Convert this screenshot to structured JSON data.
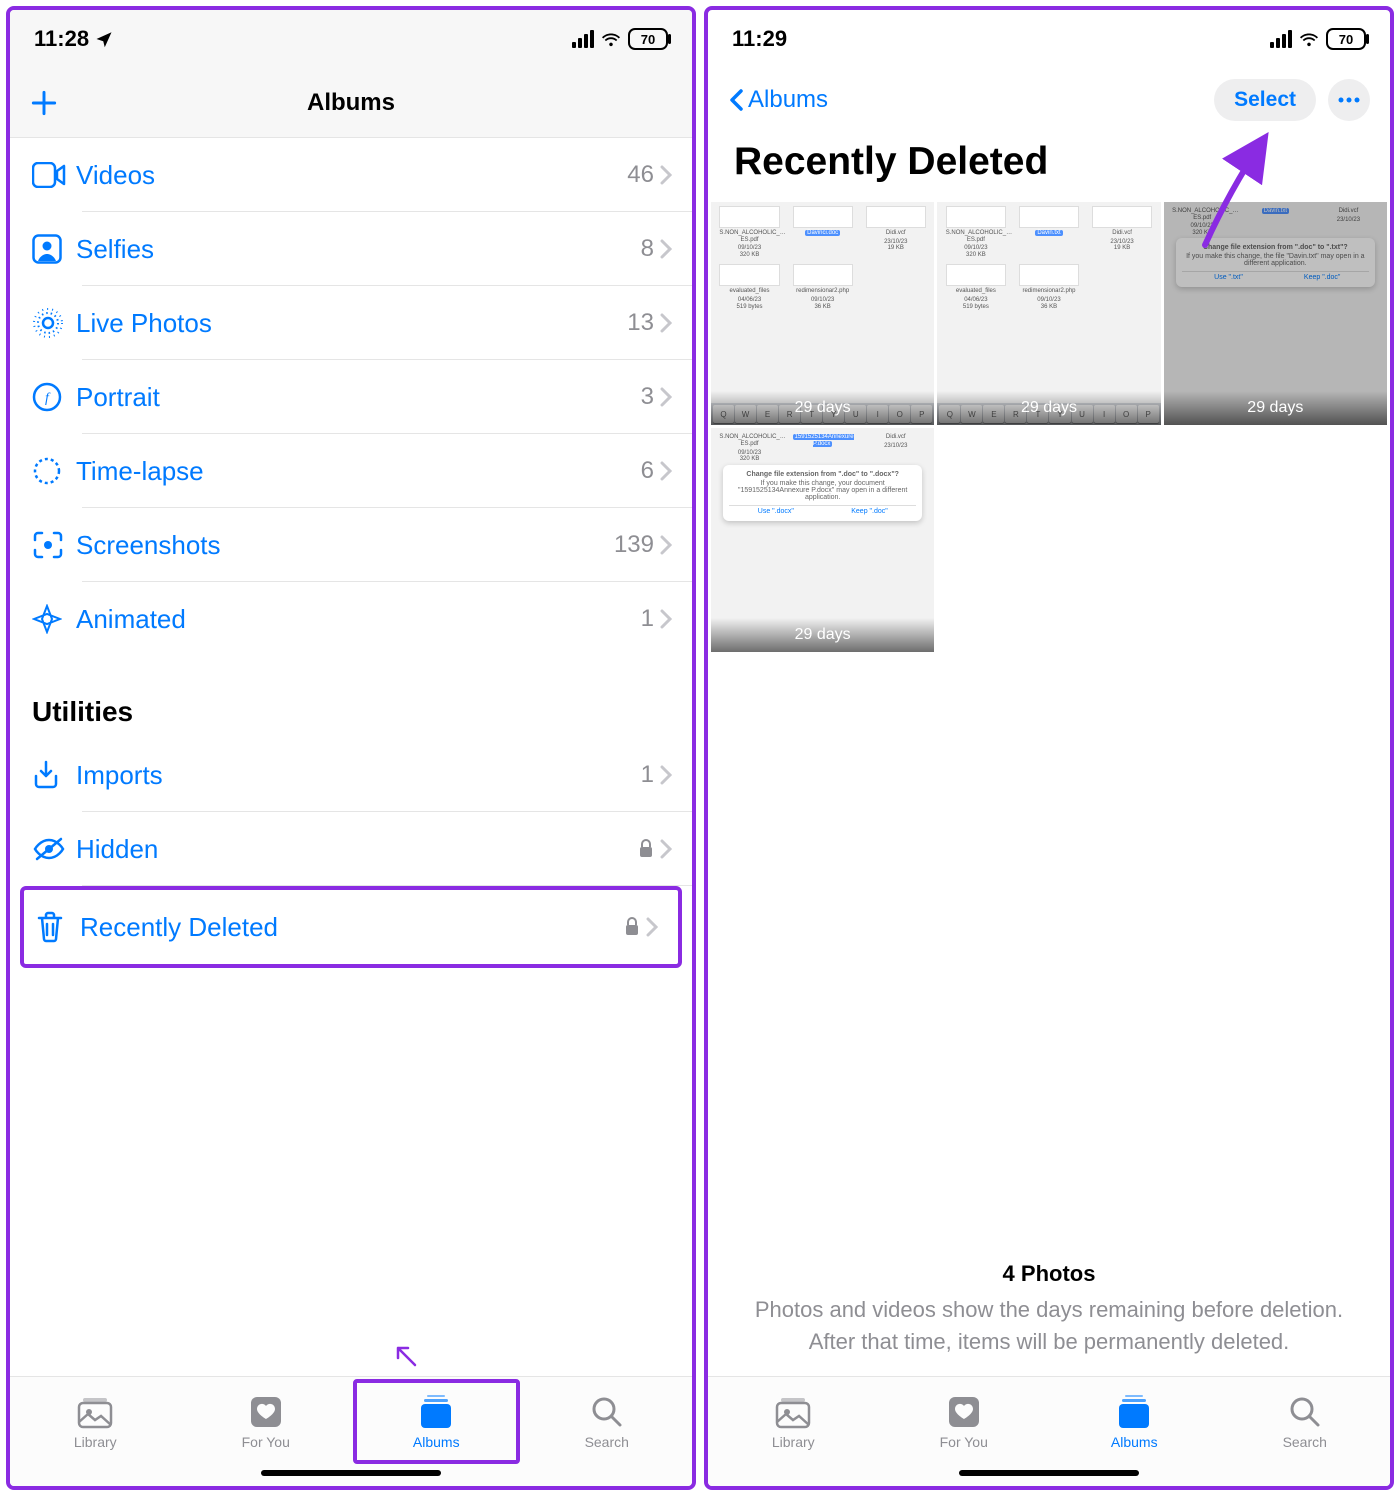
{
  "left": {
    "status": {
      "time": "11:28",
      "battery": "70"
    },
    "nav_title": "Albums",
    "media_types": [
      {
        "icon": "video",
        "label": "Videos",
        "count": "46"
      },
      {
        "icon": "person",
        "label": "Selfies",
        "count": "8"
      },
      {
        "icon": "live",
        "label": "Live Photos",
        "count": "13"
      },
      {
        "icon": "aperture",
        "label": "Portrait",
        "count": "3"
      },
      {
        "icon": "timelapse",
        "label": "Time-lapse",
        "count": "6"
      },
      {
        "icon": "screenshot",
        "label": "Screenshots",
        "count": "139"
      },
      {
        "icon": "animated",
        "label": "Animated",
        "count": "1"
      }
    ],
    "utilities_header": "Utilities",
    "utilities": [
      {
        "icon": "import",
        "label": "Imports",
        "count": "1",
        "locked": false
      },
      {
        "icon": "hidden",
        "label": "Hidden",
        "count": "",
        "locked": true
      },
      {
        "icon": "trash",
        "label": "Recently Deleted",
        "count": "",
        "locked": true,
        "highlighted": true
      }
    ]
  },
  "right": {
    "status": {
      "time": "11:29",
      "battery": "70"
    },
    "back_label": "Albums",
    "select_label": "Select",
    "page_title": "Recently Deleted",
    "thumbs": [
      {
        "days": "29 days",
        "files": [
          "S.NON_ALCOHOLIC_…ES.pdf",
          "Davinci.doc",
          "Didi.vcf",
          "evaluated_files",
          "redimensionar2.php"
        ]
      },
      {
        "days": "29 days",
        "files": [
          "S.NON_ALCOHOLIC_…ES.pdf",
          "Davin.txt",
          "Didi.vcf",
          "evaluated_files",
          "redimensionar2.php"
        ]
      },
      {
        "days": "29 days",
        "dialog": {
          "title": "Change file extension from \".doc\" to \".txt\"?",
          "body": "If you make this change, the file \"Davin.txt\" may open in a different application.",
          "btn1": "Use \".txt\"",
          "btn2": "Keep \".doc\""
        },
        "files": [
          "S.NON_ALCOHOLIC_…ES.pdf",
          "Davin.txt",
          "Didi.vcf"
        ]
      },
      {
        "days": "29 days",
        "dialog": {
          "title": "Change file extension from \".doc\" to \".docx\"?",
          "body": "If you make this change, your document \"1591525134Annexure P.docx\" may open in a different application.",
          "btn1": "Use \".docx\"",
          "btn2": "Keep \".doc\""
        },
        "files": [
          "S.NON_ALCOHOLIC_…ES.pdf",
          "1591525134Annexure P.docx",
          "Didi.vcf"
        ]
      }
    ],
    "footer_count": "4 Photos",
    "footer_body": "Photos and videos show the days remaining before deletion. After that time, items will be permanently deleted."
  },
  "tabs": [
    {
      "id": "library",
      "label": "Library"
    },
    {
      "id": "foryou",
      "label": "For You"
    },
    {
      "id": "albums",
      "label": "Albums",
      "active": true
    },
    {
      "id": "search",
      "label": "Search"
    }
  ]
}
